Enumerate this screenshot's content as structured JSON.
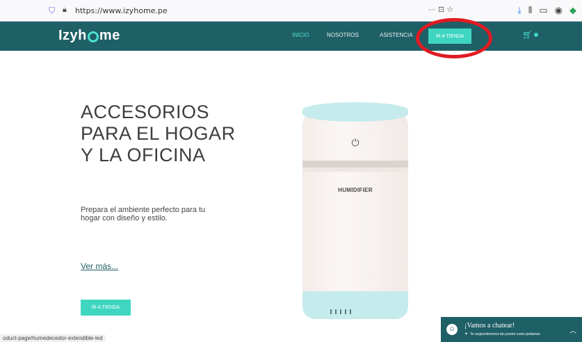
{
  "browser": {
    "url": "https://www.izyhome.pe",
    "url_actions": "··· ⊡ ☆",
    "icons": [
      "shield-icon",
      "lock-icon",
      "download-icon",
      "library-icon",
      "sidebar-icon",
      "account-icon",
      "extension-icon"
    ]
  },
  "header": {
    "logo_prefix": "Izyh",
    "logo_suffix": "me",
    "nav": [
      {
        "label": "INICIO",
        "active": true
      },
      {
        "label": "NOSOTROS",
        "active": false
      },
      {
        "label": "ASISTENCIA",
        "active": false
      }
    ],
    "tienda_label": "IR A TIENDA",
    "colors": {
      "header_bg": "#1f5f66",
      "accent": "#3fd6c1",
      "highlight": "#e11b22"
    }
  },
  "hero": {
    "title_line1": "ACCESORIOS",
    "title_line2": "PARA EL HOGAR",
    "title_line3": "Y LA OFICINA",
    "description": "Prepara el ambiente perfecto para tu hogar con diseño y estilo.",
    "ver_mas": "Ver más...",
    "cta_label": "IR A TIENDA"
  },
  "product": {
    "label": "HUMIDIFIER"
  },
  "status_bar": {
    "link": "oduct-page/humedecedor-extendible-led"
  },
  "chat": {
    "title": "¡Vamos a chatear!",
    "subtitle": "Te responderemos tan pronto como podamos"
  }
}
